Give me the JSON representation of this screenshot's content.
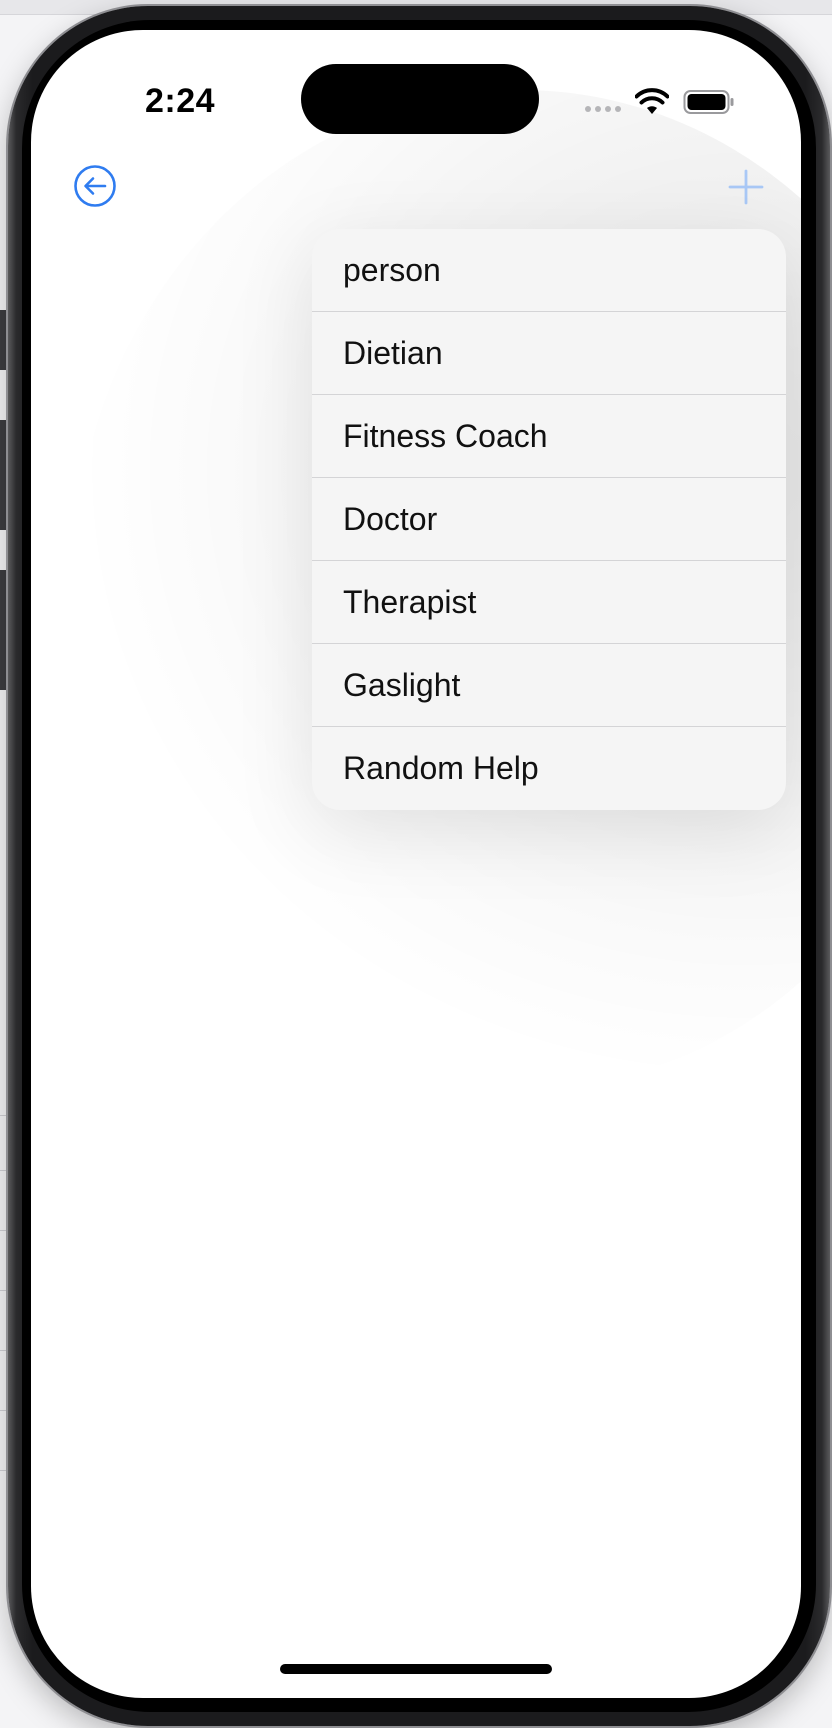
{
  "status_bar": {
    "time": "2:24",
    "icons": [
      "signal-icon",
      "wifi-icon",
      "battery-icon"
    ]
  },
  "nav": {
    "back_icon": "back-arrow-circle-icon",
    "add_icon": "plus-icon"
  },
  "menu": {
    "items": [
      {
        "label": "person"
      },
      {
        "label": "Dietian"
      },
      {
        "label": "Fitness Coach"
      },
      {
        "label": "Doctor"
      },
      {
        "label": "Therapist"
      },
      {
        "label": "Gaslight"
      },
      {
        "label": "Random Help"
      }
    ]
  },
  "colors": {
    "accent": "#2f7cf0",
    "accent_disabled": "#a9c8f6",
    "menu_background": "#f5f5f5"
  }
}
